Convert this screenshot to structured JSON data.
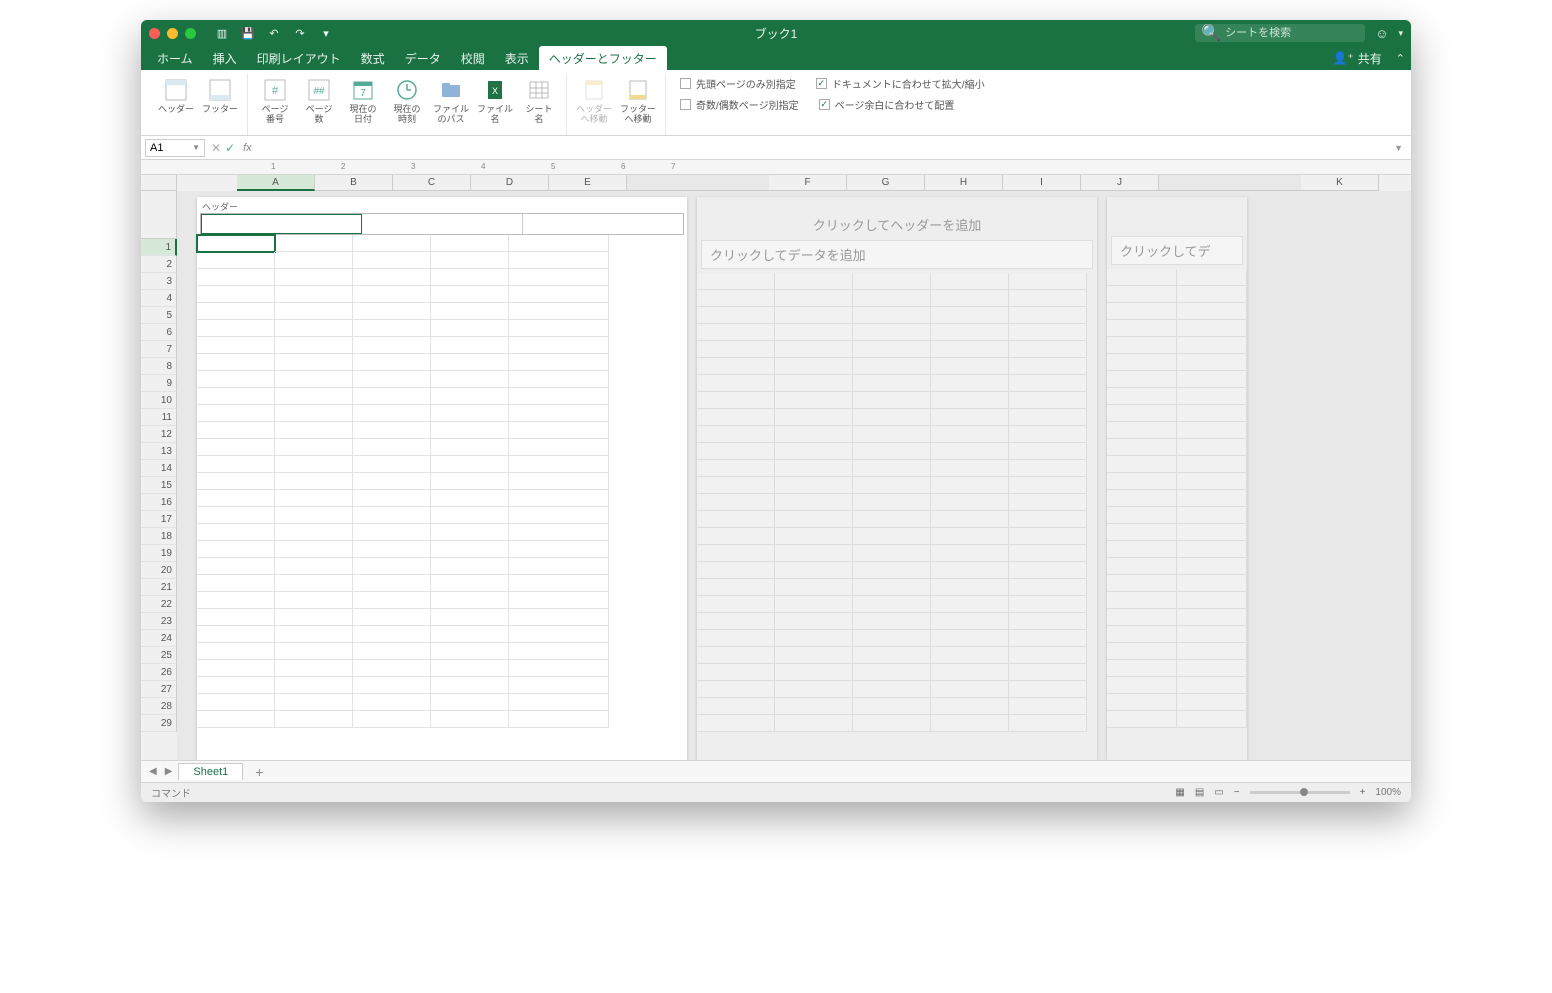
{
  "title": "ブック1",
  "search_placeholder": "シートを検索",
  "tabs": {
    "home": "ホーム",
    "insert": "挿入",
    "page_layout": "印刷レイアウト",
    "formulas": "数式",
    "data": "データ",
    "review": "校閲",
    "view": "表示",
    "header_footer": "ヘッダーとフッター"
  },
  "share": "共有",
  "ribbon": {
    "header": "ヘッダー",
    "footer": "フッター",
    "page_num": "ページ\n番号",
    "page_count": "ページ\n数",
    "date": "現在の\n日付",
    "time": "現在の\n時刻",
    "file_path": "ファイル\nのパス",
    "file_name": "ファイル\n名",
    "sheet_name": "シート\n名",
    "goto_header": "ヘッダー\nへ移動",
    "goto_footer": "フッター\nへ移動"
  },
  "checks": {
    "first_diff": "先頭ページのみ別指定",
    "odd_even": "奇数/偶数ページ別指定",
    "scale_doc": "ドキュメントに合わせて拡大/縮小",
    "align_margin": "ページ余白に合わせて配置"
  },
  "namebox": "A1",
  "ruler_marks": [
    "1",
    "2",
    "3",
    "4",
    "5",
    "6",
    "7"
  ],
  "columns": [
    "A",
    "B",
    "C",
    "D",
    "E",
    "F",
    "G",
    "H",
    "I",
    "J",
    "K"
  ],
  "rows_visible": 29,
  "header_label": "ヘッダー",
  "placeholder_header": "クリックしてヘッダーを追加",
  "placeholder_data": "クリックしてデータを追加",
  "placeholder_data_cut": "クリックしてデ",
  "sheet_tab": "Sheet1",
  "status_text": "コマンド",
  "zoom": "100%"
}
